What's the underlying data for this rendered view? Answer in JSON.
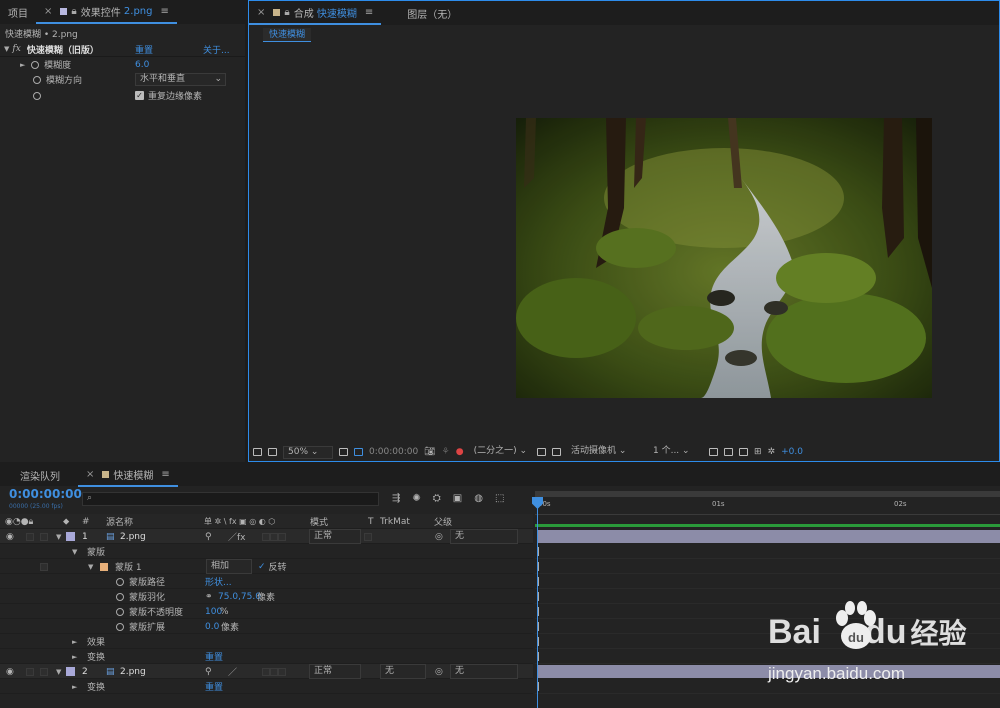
{
  "left_panel": {
    "tabs": [
      {
        "label": "项目"
      },
      {
        "label": "效果控件",
        "file": "2.png"
      }
    ],
    "breadcrumb": "快速模糊 • 2.png",
    "effect": {
      "name": "快速模糊（旧版）",
      "reset": "重置",
      "about": "关于..."
    },
    "props": [
      {
        "label": "模糊度",
        "value": "6.0"
      },
      {
        "label": "模糊方向",
        "value": "水平和垂直"
      },
      {
        "label": "重复边缘像素",
        "checked": true
      }
    ]
  },
  "viewer": {
    "tabs": [
      {
        "prefix": "合成",
        "label": "快速模糊"
      },
      {
        "label": "图层（无）"
      }
    ],
    "subtab": "快速模糊",
    "toolbar": {
      "zoom": "50%",
      "time": "0:00:00:00",
      "resolution": "(二分之一)",
      "camera": "活动摄像机",
      "views": "1 个...",
      "exposure": "+0.0"
    }
  },
  "timeline": {
    "tabs": [
      {
        "label": "渲染队列"
      },
      {
        "label": "快速模糊"
      }
    ],
    "timecode": "0:00:00:00",
    "timecode_sub": "00000 (25.00 fps)",
    "headers": {
      "num": "#",
      "source": "源名称",
      "switches": "单 ✲ \\ fx ▣ ◎ ◐ ⬡",
      "mode": "模式",
      "t": "T",
      "trkmat": "TrkMat",
      "parent": "父级"
    },
    "ruler": {
      "ticks": [
        "00s",
        "01s",
        "02s"
      ]
    },
    "layers": [
      {
        "num": "1",
        "name": "2.png",
        "mode": "正常",
        "parent": "无",
        "color": "#a8a8d8"
      },
      {
        "num": "2",
        "name": "2.png",
        "mode": "正常",
        "trkmat": "无",
        "parent": "无",
        "color": "#a8a8d8"
      }
    ],
    "mask_group": "蒙版",
    "mask": {
      "name": "蒙版 1",
      "mode": "相加",
      "invert_label": "反转",
      "props": [
        {
          "label": "蒙版路径",
          "value": "形状..."
        },
        {
          "label": "蒙版羽化",
          "value": "75.0,75.0",
          "unit": "像素"
        },
        {
          "label": "蒙版不透明度",
          "value": "100",
          "unit": "%"
        },
        {
          "label": "蒙版扩展",
          "value": "0.0",
          "unit": "像素"
        }
      ]
    },
    "effects_label": "效果",
    "transform_label": "变换",
    "reset": "重置"
  },
  "watermark": {
    "brand": "Bai",
    "brand2": "du",
    "site_cn": "经验",
    "url": "jingyan.baidu.com"
  },
  "colors": {
    "accent": "#3f8fe0",
    "layer_bar": "#8c8ca8",
    "green": "#2a9a3a",
    "mask_swatch": "#e7b07a"
  }
}
